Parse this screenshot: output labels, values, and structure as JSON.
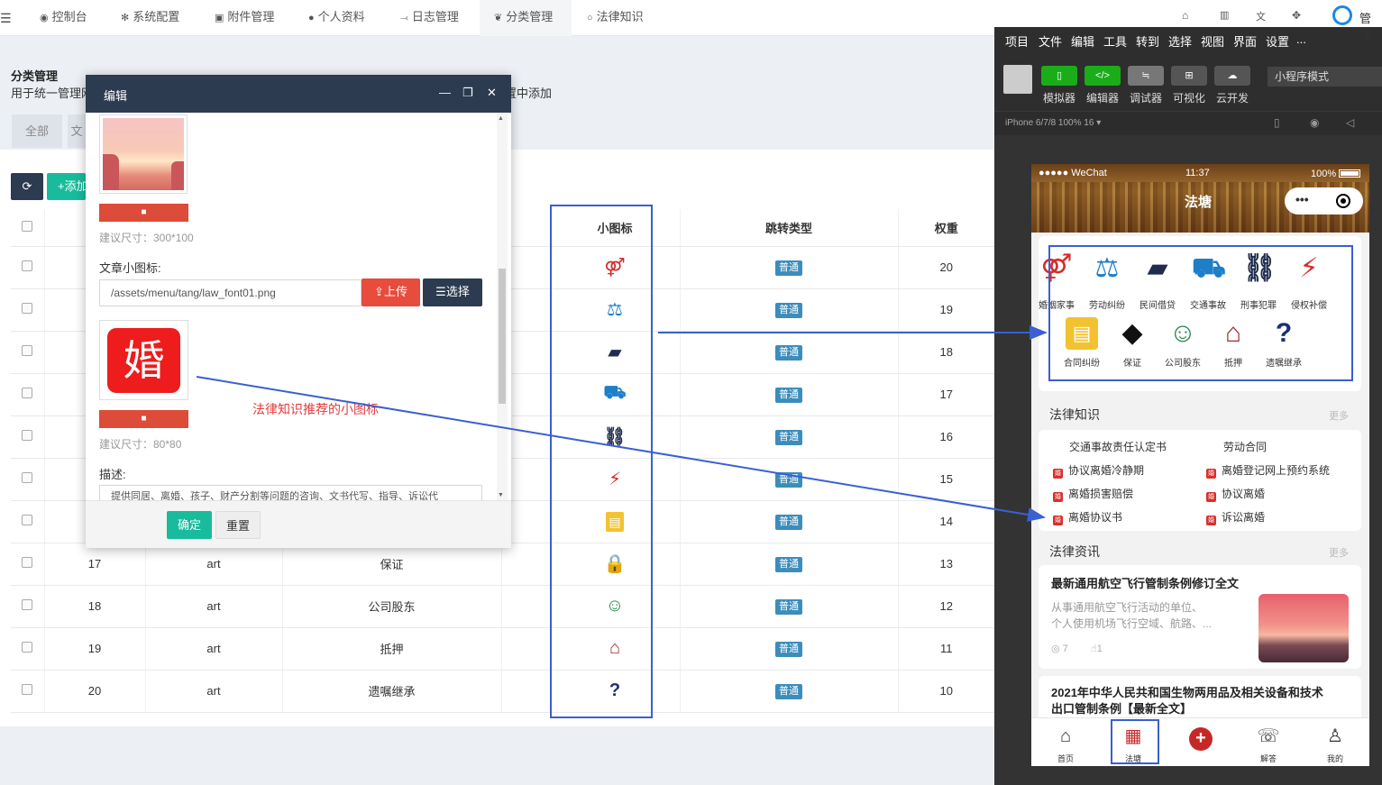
{
  "topnav": {
    "items": [
      {
        "label": "控制台",
        "icon": "dashboard-icon"
      },
      {
        "label": "系统配置",
        "icon": "gear-icon"
      },
      {
        "label": "附件管理",
        "icon": "image-icon"
      },
      {
        "label": "个人资料",
        "icon": "user-icon"
      },
      {
        "label": "日志管理",
        "icon": "log-icon"
      },
      {
        "label": "分类管理",
        "icon": "leaf-icon"
      },
      {
        "label": "法律知识",
        "icon": "circle-icon"
      }
    ],
    "right_icons": [
      "home-icon",
      "trash-icon",
      "translate-icon",
      "fullscreen-icon"
    ],
    "right_text": "管理"
  },
  "page": {
    "title": "分类管理",
    "desc": "用于统一管理网",
    "desc_tail": "置中添加",
    "tabs": [
      "全部",
      "文"
    ],
    "refresh_icon": "refresh-icon",
    "add_label": "添加"
  },
  "table": {
    "headers": {
      "icon": "小图标",
      "jump": "跳转类型",
      "weight": "权重"
    },
    "rows": [
      {
        "id": "",
        "type": "",
        "name": "",
        "badge": "普通",
        "weight": "20"
      },
      {
        "id": "",
        "type": "",
        "name": "",
        "badge": "普通",
        "weight": "19"
      },
      {
        "id": "",
        "type": "",
        "name": "",
        "badge": "普通",
        "weight": "18"
      },
      {
        "id": "",
        "type": "",
        "name": "",
        "badge": "普通",
        "weight": "17"
      },
      {
        "id": "",
        "type": "",
        "name": "",
        "badge": "普通",
        "weight": "16"
      },
      {
        "id": "",
        "type": "",
        "name": "",
        "badge": "普通",
        "weight": "15"
      },
      {
        "id": "",
        "type": "",
        "name": "",
        "badge": "普通",
        "weight": "14"
      },
      {
        "id": "17",
        "type": "art",
        "name": "保证",
        "badge": "普通",
        "weight": "13"
      },
      {
        "id": "18",
        "type": "art",
        "name": "公司股东",
        "badge": "普通",
        "weight": "12"
      },
      {
        "id": "19",
        "type": "art",
        "name": "抵押",
        "badge": "普通",
        "weight": "11"
      },
      {
        "id": "20",
        "type": "art",
        "name": "遗嘱继承",
        "badge": "普通",
        "weight": "10"
      }
    ]
  },
  "modal": {
    "title": "编辑",
    "hint1": "建议尺寸：300*100",
    "icon_label": "文章小图标:",
    "icon_path": "/assets/menu/tang/law_font01.png",
    "upload": "上传",
    "select": "选择",
    "preview_char": "婚",
    "hint2": "建议尺寸：80*80",
    "desc_label": "描述:",
    "desc_value": "提供同居、离婚、孩子、财产分割等问题的咨询、文书代写、指导、诉讼代",
    "ok": "确定",
    "reset": "重置"
  },
  "annotation": "法律知识推荐的小图标",
  "ide": {
    "menu": [
      "项目",
      "文件",
      "编辑",
      "工具",
      "转到",
      "选择",
      "视图",
      "界面",
      "设置",
      "..."
    ],
    "tools": [
      "模拟器",
      "编辑器",
      "调试器",
      "可视化",
      "云开发"
    ],
    "mode": "小程序模式",
    "device": "iPhone 6/7/8 100% 16 ▾"
  },
  "phone": {
    "carrier": "●●●●● WeChat",
    "time": "11:37",
    "battery": "100%",
    "title": "法塘",
    "grid": [
      "婚姻家事",
      "劳动纠纷",
      "民间借贷",
      "交通事故",
      "刑事犯罪",
      "侵权补偿",
      "合同纠纷",
      "保证",
      "公司股东",
      "抵押",
      "遗嘱继承"
    ],
    "law_title": "法律知识",
    "more": "更多",
    "law_items": [
      "交通事故责任认定书",
      "劳动合同",
      "协议离婚冷静期",
      "离婚登记网上预约系统",
      "离婚损害赔偿",
      "协议离婚",
      "离婚协议书",
      "诉讼离婚"
    ],
    "news_title": "法律资讯",
    "news1_title": "最新通用航空飞行管制条例修订全文",
    "news1_desc1": "从事通用航空飞行活动的单位、",
    "news1_desc2": "个人使用机场飞行空域、航路、...",
    "news1_views": "7",
    "news1_likes": "1",
    "news2_title1": "2021年中华人民共和国生物两用品及相关设备和技术",
    "news2_title2": "出口管制条例【最新全文】",
    "tabs": [
      "首页",
      "法塘",
      "",
      "解答",
      "我的"
    ]
  }
}
